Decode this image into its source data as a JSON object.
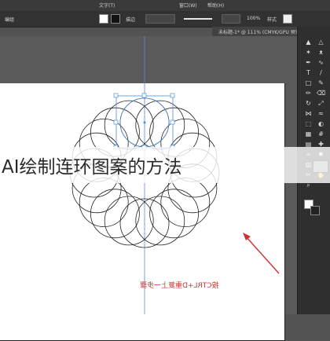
{
  "app": {
    "menu_left": "窗口(W)",
    "menu_right": "帮助(H)",
    "menu_mid": "文字(T)"
  },
  "control_bar": {
    "group_label": "编组",
    "stroke_label": "描边",
    "opacity_value": "100%",
    "style_label": "样式"
  },
  "document": {
    "tab_title": "未标题-1* @ 111% (CMYK/GPU 预览)"
  },
  "overlay": {
    "title": "AI绘制连环图案的方法"
  },
  "annotation": {
    "text": "按CTRL+D重复上一步骤",
    "color": "#cc3333"
  },
  "colors": {
    "selection": "#4a90d9",
    "artboard": "#ffffff",
    "canvas": "#5a5a5a",
    "arrow": "#cc3333"
  },
  "tools": {
    "icons": [
      "selection-icon",
      "direct-select-icon",
      "magic-wand-icon",
      "lasso-icon",
      "pen-icon",
      "curvature-icon",
      "type-icon",
      "line-icon",
      "rectangle-icon",
      "paintbrush-icon",
      "pencil-icon",
      "eraser-icon",
      "rotate-icon",
      "scale-icon",
      "width-icon",
      "warp-icon",
      "free-transform-icon",
      "shape-builder-icon",
      "perspective-icon",
      "mesh-icon",
      "gradient-icon",
      "eyedropper-icon",
      "blend-icon",
      "symbol-sprayer-icon",
      "column-graph-icon",
      "artboard-icon",
      "slice-icon",
      "hand-icon",
      "zoom-icon"
    ]
  }
}
